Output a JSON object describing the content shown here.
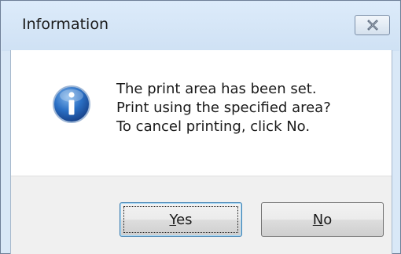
{
  "window": {
    "title": "Information"
  },
  "icons": {
    "close": "close-icon",
    "information": "information-icon"
  },
  "message": {
    "lines": [
      "The print area has been set.",
      "Print using the specified area?",
      "To cancel printing, click No."
    ]
  },
  "buttons": {
    "yes": {
      "mnemonic": "Y",
      "rest": "es"
    },
    "no": {
      "mnemonic": "N",
      "rest": "o"
    }
  },
  "colors": {
    "icon_blue": "#1f5fb4",
    "title_bar": "#d9e8f7"
  }
}
